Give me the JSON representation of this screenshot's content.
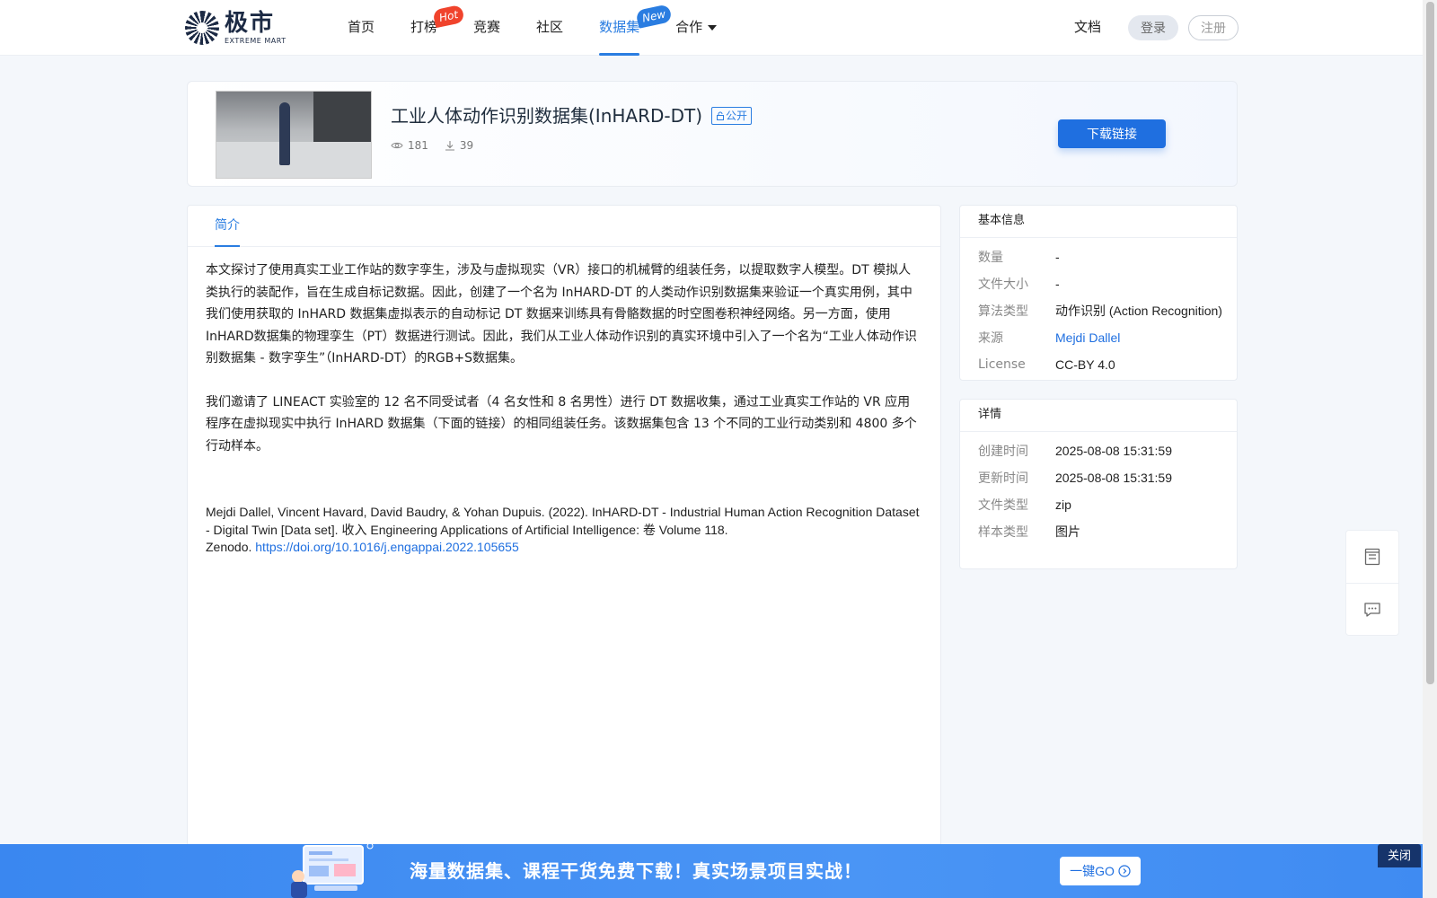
{
  "header": {
    "logo_cn": "极市",
    "logo_en": "EXTREME MART",
    "nav": [
      {
        "label": "首页",
        "active": false
      },
      {
        "label": "打榜",
        "badge": "Hot",
        "active": false
      },
      {
        "label": "竞赛",
        "active": false
      },
      {
        "label": "社区",
        "active": false
      },
      {
        "label": "数据集",
        "badge": "New",
        "active": true
      },
      {
        "label": "合作",
        "dropdown": true,
        "active": false
      }
    ],
    "doc_label": "文档",
    "login_label": "登录",
    "register_label": "注册"
  },
  "dataset": {
    "title": "工业人体动作识别数据集(InHARD-DT)",
    "visibility": "公开",
    "views": "181",
    "downloads": "39",
    "download_button": "下载链接"
  },
  "intro": {
    "tab_label": "简介",
    "paragraph1": "本文探讨了使用真实工业工作站的数字孪生，涉及与虚拟现实（VR）接口的机械臂的组装任务，以提取数字人模型。DT 模拟人类执行的装配作，旨在生成自标记数据。因此，创建了一个名为 InHARD-DT 的人类动作识别数据集来验证一个真实用例，其中我们使用获取的 InHARD 数据集虚拟表示的自动标记 DT 数据来训练具有骨骼数据的时空图卷积神经网络。另一方面，使用InHARD数据集的物理孪生（PT）数据进行测试。因此，我们从工业人体动作识别的真实环境中引入了一个名为“工业人体动作识别数据集 - 数字孪生”（InHARD-DT）的RGB+S数据集。",
    "paragraph2": "我们邀请了 LINEACT 实验室的 12 名不同受试者（4 名女性和 8 名男性）进行 DT 数据收集，通过工业真实工作站的 VR 应用程序在虚拟现实中执行 InHARD 数据集（下面的链接）的相同组装任务。该数据集包含 13 个不同的工业行动类别和 4800 多个行动样本。",
    "citation": "Mejdi Dallel, Vincent Havard, David Baudry, & Yohan Dupuis. (2022). InHARD-DT - Industrial Human Action Recognition Dataset - Digital Twin [Data set]. 收入 Engineering Applications of Artificial Intelligence: 卷 Volume 118.",
    "citation_prefix": "Zenodo. ",
    "citation_link": "https://doi.org/10.1016/j.engappai.2022.105655"
  },
  "basic_info": {
    "heading": "基本信息",
    "rows": [
      {
        "label": "数量",
        "value": "-"
      },
      {
        "label": "文件大小",
        "value": "-"
      },
      {
        "label": "算法类型",
        "value": "动作识别 (Action Recognition)"
      },
      {
        "label": "来源",
        "value": "Mejdi Dallel"
      },
      {
        "label": "License",
        "value": "CC-BY 4.0"
      }
    ]
  },
  "details": {
    "heading": "详情",
    "rows": [
      {
        "label": "创建时间",
        "value": "2025-08-08 15:31:59"
      },
      {
        "label": "更新时间",
        "value": "2025-08-08 15:31:59"
      },
      {
        "label": "文件类型",
        "value": "zip"
      },
      {
        "label": "样本类型",
        "value": "图片"
      }
    ]
  },
  "floating_tools": [
    "document-icon",
    "message-icon"
  ],
  "banner": {
    "text": "海量数据集、课程干货免费下载！真实场景项目实战！",
    "go_label": "一键GO",
    "close_label": "关闭"
  },
  "colors": {
    "accent": "#2a7de1",
    "hot_badge": "#f0432c",
    "banner": "#3a87f0"
  }
}
